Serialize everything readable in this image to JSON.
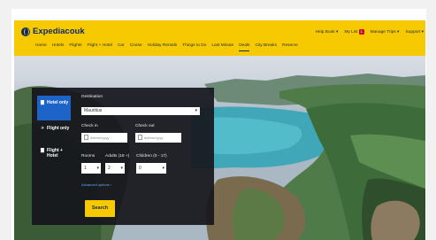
{
  "header": {
    "logo_text": "Expediacouk",
    "utility": [
      {
        "label": "Help Book ▾"
      },
      {
        "label": "My List",
        "badge": "1"
      },
      {
        "label": "Manage Trips ▾"
      },
      {
        "label": "Support ▾"
      }
    ],
    "nav": [
      "Home",
      "Hotels",
      "Flights",
      "Flight + Hotel",
      "Car",
      "Cruise",
      "Holiday Rentals",
      "Things to Do",
      "Last Minute",
      "Deals",
      "City Breaks",
      "Reserve"
    ],
    "active_nav": "Deals",
    "colors": {
      "brand": "#f6c900",
      "logo": "#0b2a6a",
      "panel": "#16161c",
      "tab_active": "#1e64c8"
    }
  },
  "search_panel": {
    "tabs": [
      {
        "icon": "bed-icon",
        "glyph": "▇",
        "label": "Hotel only",
        "active": true
      },
      {
        "icon": "plane-icon",
        "glyph": "✈",
        "label": "Flight only",
        "active": false
      },
      {
        "icon": "plane-bed-icon",
        "glyph": "▇",
        "label": "Flight + Hotel",
        "active": false
      }
    ],
    "destination": {
      "label": "Destination",
      "value": "Mauritius"
    },
    "check_in": {
      "label": "Check in",
      "placeholder": "dd/mm/yyyy"
    },
    "check_out": {
      "label": "Check out",
      "placeholder": "dd/mm/yyyy"
    },
    "rooms": {
      "label": "Rooms",
      "value": "1"
    },
    "adults": {
      "label": "Adults (18 +)",
      "value": "2"
    },
    "children": {
      "label": "Children (0 - 17)",
      "value": "0"
    },
    "advanced_link": "Advanced options ›",
    "search_button": "Search"
  }
}
